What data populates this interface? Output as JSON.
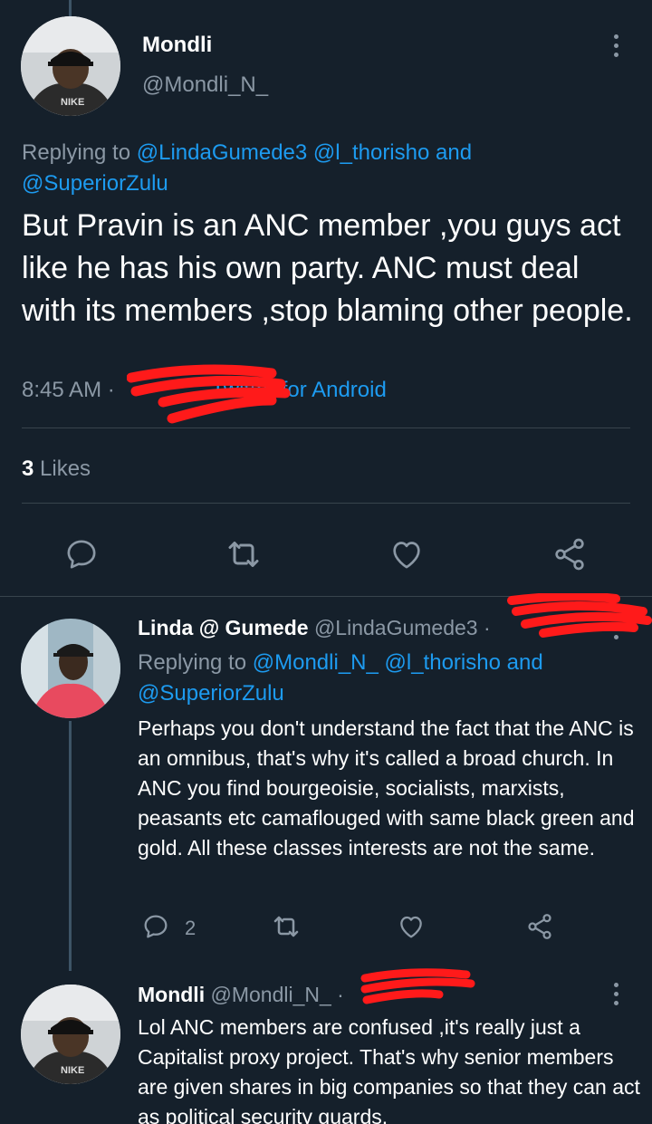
{
  "main_tweet": {
    "display_name": "Mondli",
    "handle": "@Mondli_N_",
    "replying_prefix": "Replying to",
    "replying_users": [
      "@LindaGumede3",
      "@l_thorisho",
      "and",
      "@SuperiorZulu"
    ],
    "text": "But Pravin is an ANC member ,you guys act like he has his own party. ANC must deal with its members ,stop blaming other people.",
    "time": "8:45 AM",
    "separator": "·",
    "source": "Twitter for Android",
    "likes_count": "3",
    "likes_label": "Likes"
  },
  "reply_1": {
    "display_name": "Linda @ Gumede",
    "handle": "@LindaGumede3",
    "separator": "·",
    "replying_prefix": "Replying to",
    "replying_users": [
      "@Mondli_N_",
      "@l_thorisho",
      "and",
      "@SuperiorZulu"
    ],
    "text": "Perhaps you don't understand the fact that the ANC is an omnibus, that's why it's called a broad church. In ANC you find bourgeoisie, socialists, marxists, peasants etc camaflouged with same black green and gold. All these classes interests are not the same.",
    "reply_count": "2"
  },
  "reply_2": {
    "display_name": "Mondli",
    "handle": "@Mondli_N_",
    "separator": "·",
    "text": "Lol ANC members are confused ,it's really just a Capitalist proxy project. That's why senior members are given shares in big companies so that they can act as political security guards."
  },
  "colors": {
    "background": "#15202b",
    "text": "#ffffff",
    "muted": "#8b98a5",
    "link": "#1d9bf0",
    "redaction": "#ff1a1a"
  },
  "icons": [
    "reply-icon",
    "retweet-icon",
    "like-icon",
    "share-icon",
    "more-icon"
  ]
}
